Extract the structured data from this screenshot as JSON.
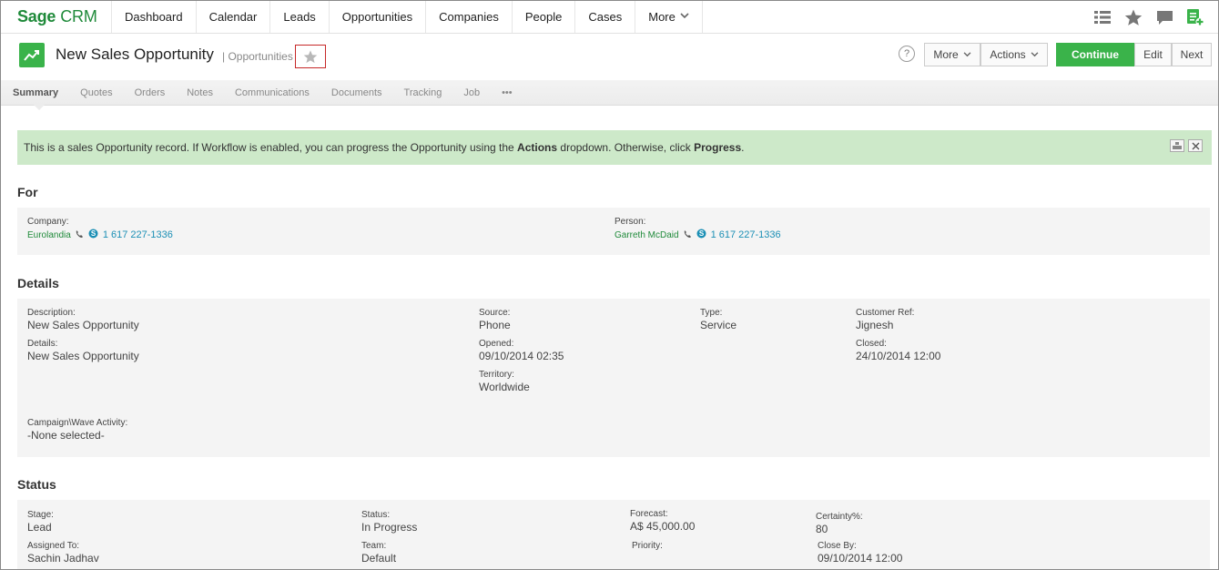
{
  "nav": {
    "logo_bold": "Sage",
    "logo_rest": "CRM",
    "items": [
      "Dashboard",
      "Calendar",
      "Leads",
      "Opportunities",
      "Companies",
      "People",
      "Cases",
      "More"
    ]
  },
  "header": {
    "title": "New Sales Opportunity",
    "subtitle": "| Opportunities",
    "help": "?",
    "more": "More",
    "actions": "Actions",
    "continue": "Continue",
    "edit": "Edit",
    "next": "Next"
  },
  "tabs": [
    "Summary",
    "Quotes",
    "Orders",
    "Notes",
    "Communications",
    "Documents",
    "Tracking",
    "Job",
    "•••"
  ],
  "banner": {
    "text1": "This is a sales Opportunity record. If Workflow is enabled, you can progress the Opportunity using the ",
    "bold1": "Actions",
    "text2": " dropdown. Otherwise, click ",
    "bold2": "Progress",
    "text3": "."
  },
  "for_section": {
    "title": "For",
    "company_label": "Company:",
    "company_value": "Eurolandia",
    "company_phone": "1 617 227-1336",
    "person_label": "Person:",
    "person_value": "Garreth McDaid",
    "person_phone": "1 617 227-1336"
  },
  "details": {
    "title": "Details",
    "description_label": "Description:",
    "description_value": "New Sales Opportunity",
    "details_label": "Details:",
    "details_value": "New Sales Opportunity",
    "source_label": "Source:",
    "source_value": "Phone",
    "opened_label": "Opened:",
    "opened_value": "09/10/2014 02:35",
    "territory_label": "Territory:",
    "territory_value": "Worldwide",
    "type_label": "Type:",
    "type_value": "Service",
    "custref_label": "Customer Ref:",
    "custref_value": "Jignesh",
    "closed_label": "Closed:",
    "closed_value": "24/10/2014 12:00",
    "campaign_label": "Campaign\\Wave Activity:",
    "campaign_value": "-None selected-"
  },
  "status": {
    "title": "Status",
    "stage_label": "Stage:",
    "stage_value": "Lead",
    "assigned_label": "Assigned To:",
    "assigned_value": "Sachin Jadhav",
    "status_label": "Status:",
    "status_value": "In Progress",
    "team_label": "Team:",
    "team_value": "Default",
    "forecast_label": "Forecast:",
    "forecast_value": "A$ 45,000.00",
    "priority_label": "Priority:",
    "certainty_label": "Certainty%:",
    "certainty_value": "80",
    "closeby_label": "Close By:",
    "closeby_value": "09/10/2014 12:00"
  },
  "colors": {
    "brand": "#1f8a3a",
    "continue": "#3ab34a",
    "banner": "#cde9c9",
    "phone_link": "#1b8fb5"
  }
}
